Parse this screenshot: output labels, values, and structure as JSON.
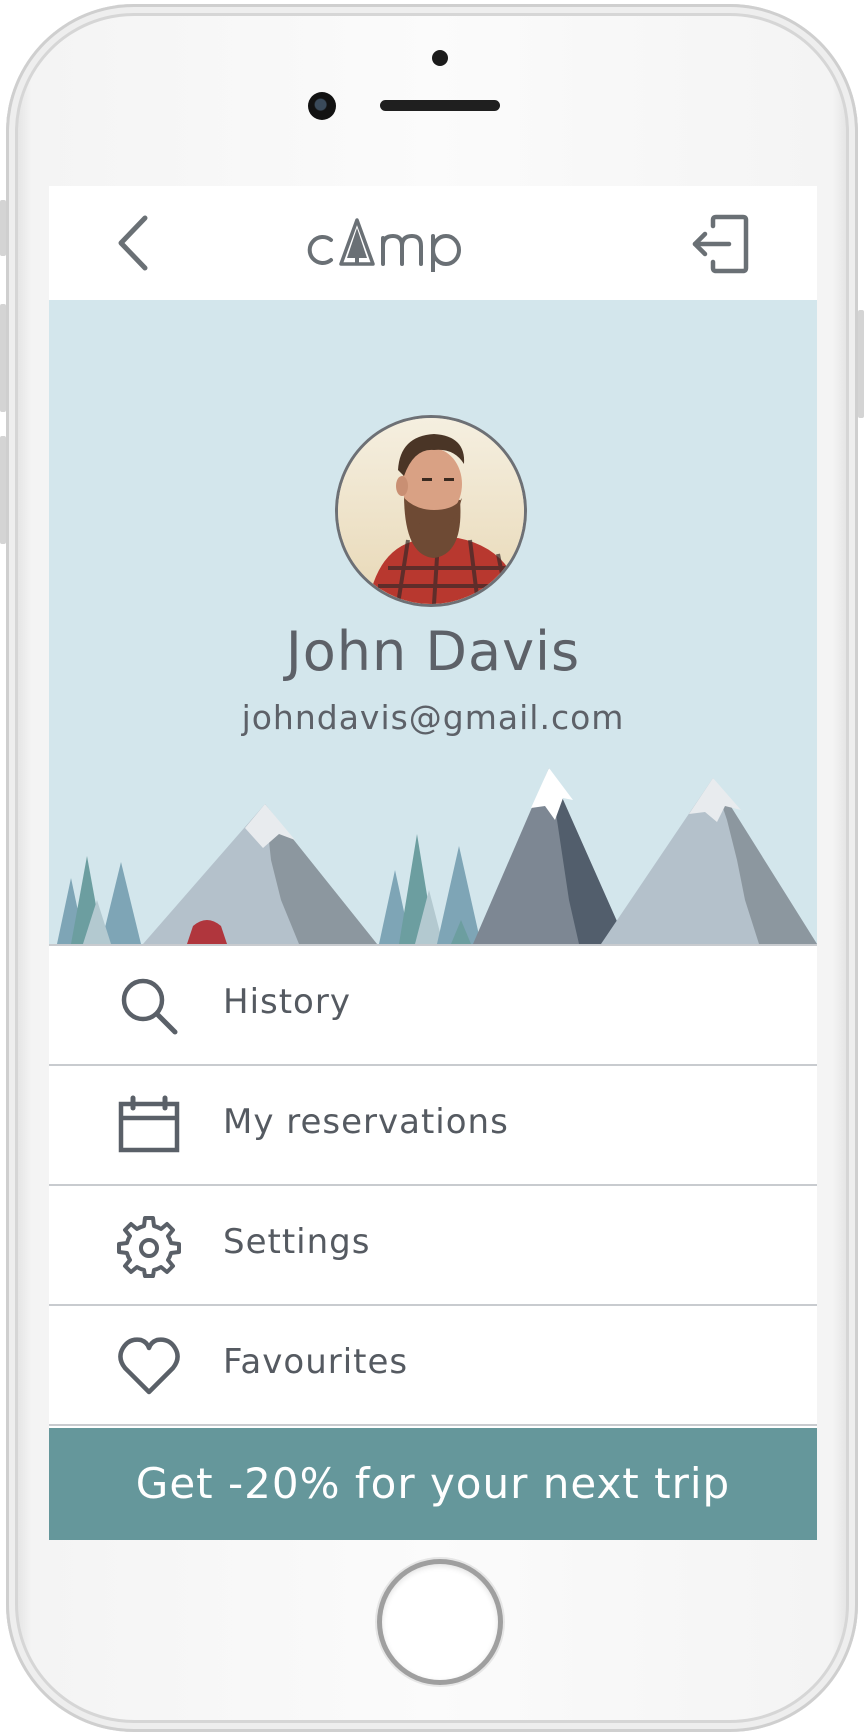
{
  "header": {
    "app_name": "camp",
    "brand_color": "#6a7075"
  },
  "profile": {
    "name": "John Davis",
    "email": "johndavis@gmail.com",
    "hero_bg": "#d3e6ec"
  },
  "menu": {
    "items": [
      {
        "label": "History",
        "icon": "search-icon"
      },
      {
        "label": "My reservations",
        "icon": "calendar-icon"
      },
      {
        "label": "Settings",
        "icon": "gear-icon"
      },
      {
        "label": "Favourites",
        "icon": "heart-icon"
      }
    ]
  },
  "promo": {
    "label": "Get -20% for your next trip",
    "color": "#65979b"
  }
}
